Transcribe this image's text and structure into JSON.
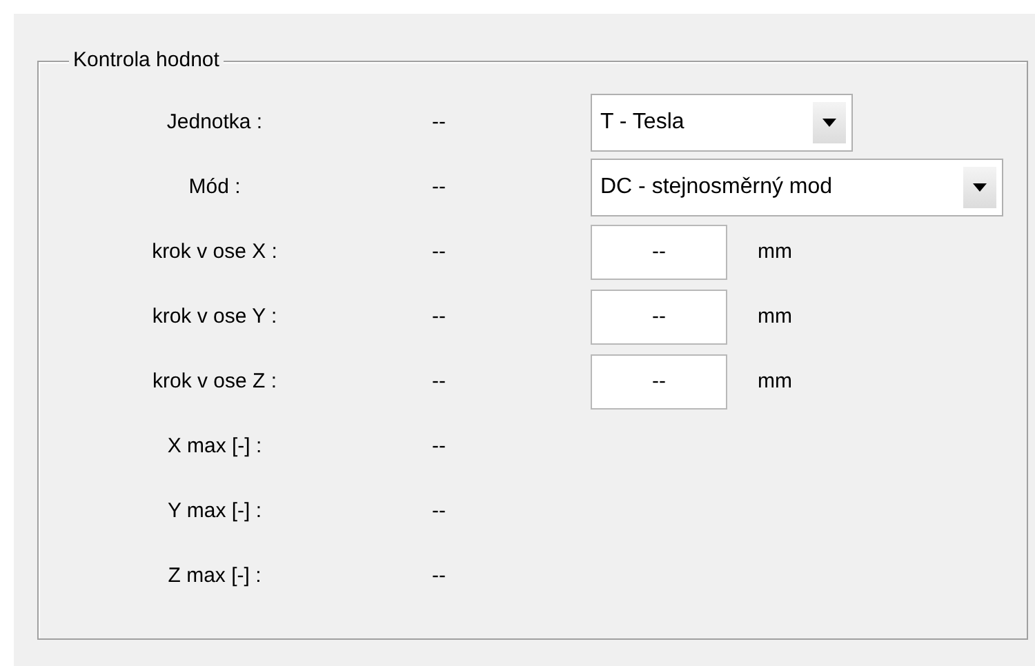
{
  "group": {
    "title": "Kontrola hodnot"
  },
  "rows": [
    {
      "label": "Jednotka :",
      "value": "--",
      "kind": "dropdown",
      "selection": "T - Tesla",
      "wide": false
    },
    {
      "label": "Mód :",
      "value": "--",
      "kind": "dropdown",
      "selection": "DC - stejnosměrný mod",
      "wide": true
    },
    {
      "label": "krok v ose X :",
      "value": "--",
      "kind": "field",
      "field_value": "--",
      "unit": "mm"
    },
    {
      "label": "krok v ose Y :",
      "value": "--",
      "kind": "field",
      "field_value": "--",
      "unit": "mm"
    },
    {
      "label": "krok v ose Z :",
      "value": "--",
      "kind": "field",
      "field_value": "--",
      "unit": "mm"
    },
    {
      "label": "X max [-] :",
      "value": "--",
      "kind": "plain"
    },
    {
      "label": "Y max [-] :",
      "value": "--",
      "kind": "plain"
    },
    {
      "label": "Z max [-] :",
      "value": "--",
      "kind": "plain"
    }
  ]
}
